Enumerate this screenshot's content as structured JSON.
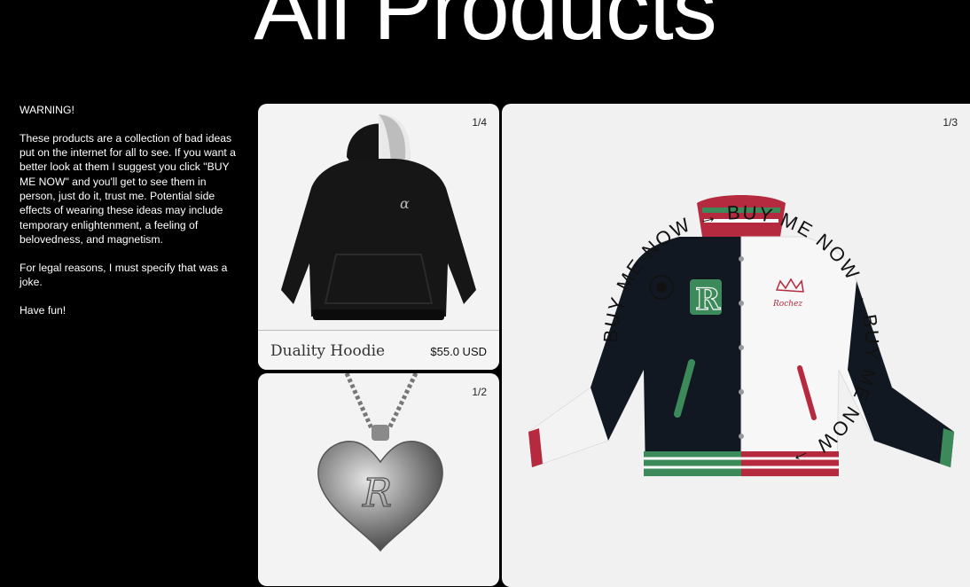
{
  "page": {
    "title": "All Products"
  },
  "notice": {
    "heading": "WARNING!",
    "body": "These products are a collection of bad ideas put on the internet for all to see. If you want a better look at them I suggest you click \"BUY ME NOW\" and you'll get to see them in person, just do it, trust me. Potential side effects of wearing these ideas may include temporary enlightenment, a feeling of belovedness, and magnetism.",
    "legal": "For legal reasons, I must specify that was a joke.",
    "signoff": "Have fun!"
  },
  "products": [
    {
      "counter": "1/4",
      "name": "Duality Hoodie",
      "price": "$55.0 USD"
    },
    {
      "counter": "1/2"
    },
    {
      "counter": "1/3",
      "buy_text": "BUY ME NOW → BUY ME NOW → BUY ME NOW → "
    }
  ],
  "colors": {
    "background": "#000000",
    "card": "#f3f3f3",
    "accent_green": "#3f8a5a",
    "accent_red": "#b8283f"
  },
  "icons": [
    "hoodie-image",
    "heart-locket-image",
    "varsity-jacket-image",
    "cursor-dot-icon"
  ]
}
